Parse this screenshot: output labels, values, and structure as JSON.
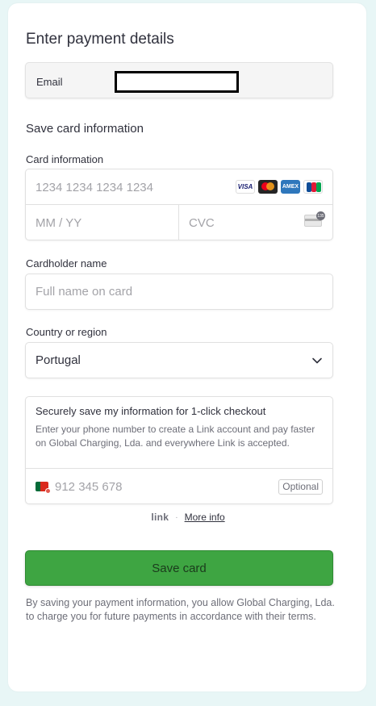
{
  "title": "Enter payment details",
  "email": {
    "label": "Email",
    "value": ""
  },
  "section_title": "Save card information",
  "card": {
    "label": "Card information",
    "number_placeholder": "1234 1234 1234 1234",
    "expiry_placeholder": "MM / YY",
    "cvc_placeholder": "CVC",
    "brands": [
      "VISA",
      "Mastercard",
      "AMEX",
      "JCB"
    ],
    "cvc_badge": "135"
  },
  "cardholder": {
    "label": "Cardholder name",
    "placeholder": "Full name on card"
  },
  "country": {
    "label": "Country or region",
    "value": "Portugal"
  },
  "link": {
    "title": "Securely save my information for 1-click checkout",
    "description": "Enter your phone number to create a Link account and pay faster on Global Charging, Lda. and everywhere Link is accepted.",
    "phone_placeholder": "912 345 678",
    "optional": "Optional",
    "logo": "link",
    "separator": "·",
    "more_info": "More info"
  },
  "save_button": "Save card",
  "legal": "By saving your payment information, you allow Global Charging, Lda. to charge you for future payments in accordance with their terms.",
  "colors": {
    "accent": "#3ea542",
    "background": "#e8f6f6"
  }
}
